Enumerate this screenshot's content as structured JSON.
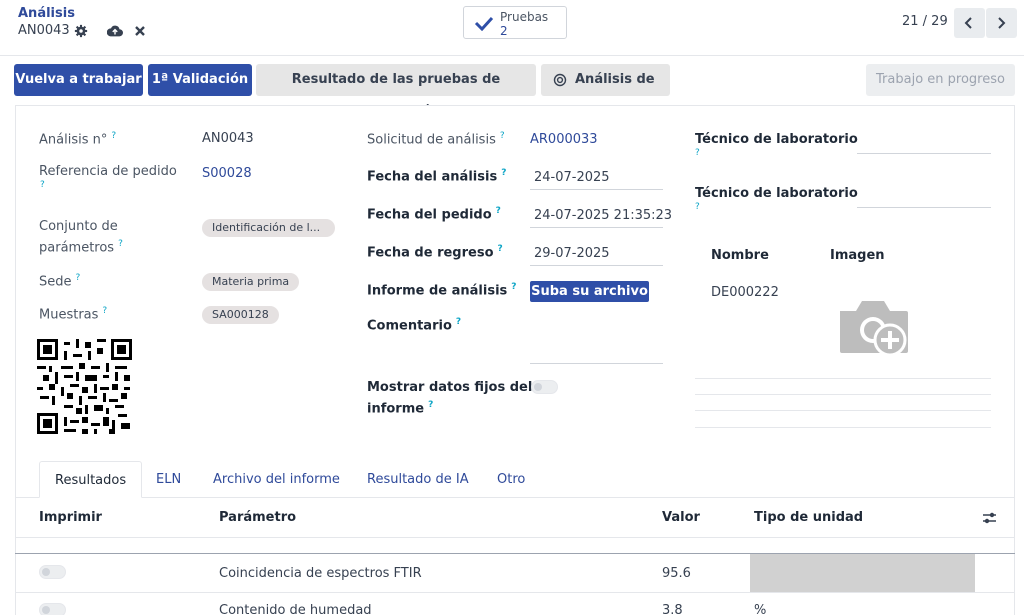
{
  "header": {
    "breadcrumb": "Análisis",
    "record_name": "AN0043",
    "smart_button": {
      "label": "Pruebas",
      "count": "2"
    },
    "pager": "21 / 29"
  },
  "actions": {
    "rework": "Vuelva a trabajar",
    "first_validation": "1ª Validación",
    "import_results": "Resultado de las pruebas de importación",
    "ai_analysis": "Análisis de IA",
    "status": "Trabajo en progreso"
  },
  "form": {
    "analysis_no": {
      "label": "Análisis n°",
      "value": "AN0043"
    },
    "order_ref": {
      "label": "Referencia de pedido",
      "value": "S00028"
    },
    "param_set": {
      "label_line1": "Conjunto de",
      "label_line2": "parámetros",
      "value": "Identificación de l..."
    },
    "site": {
      "label": "Sede",
      "value": "Materia prima"
    },
    "samples": {
      "label": "Muestras",
      "value": "SA000128"
    },
    "request": {
      "label": "Solicitud de análisis",
      "value": "AR000033"
    },
    "analysis_date": {
      "label": "Fecha del análisis",
      "value": "24-07-2025"
    },
    "order_date": {
      "label": "Fecha del pedido",
      "value": "24-07-2025 21:35:23"
    },
    "return_date": {
      "label": "Fecha de regreso",
      "value": "29-07-2025"
    },
    "report": {
      "label": "Informe de análisis",
      "button": "Suba su archivo"
    },
    "comment": {
      "label": "Comentario"
    },
    "fixed_data": {
      "label_line1": "Mostrar datos fijos del",
      "label_line2": "informe"
    },
    "technician1": {
      "label": "Técnico de laboratorio"
    },
    "technician2": {
      "label": "Técnico de laboratorio"
    },
    "equipment": {
      "col_name": "Nombre",
      "col_image": "Imagen",
      "name": "DE000222"
    }
  },
  "tabs": [
    "Resultados",
    "ELN",
    "Archivo del informe",
    "Resultado de IA",
    "Otro"
  ],
  "table": {
    "headers": {
      "print": "Imprimir",
      "parameter": "Parámetro",
      "value": "Valor",
      "unit_type": "Tipo de unidad"
    },
    "rows": [
      {
        "parameter": "Coincidencia de espectros FTIR",
        "value": "95.6",
        "unit": ""
      },
      {
        "parameter": "Contenido de humedad",
        "value": "3.8",
        "unit": "%"
      }
    ]
  },
  "colors": {
    "primary": "#2f4fa8",
    "link": "#2f4a9a",
    "help": "#0ea5c6"
  }
}
